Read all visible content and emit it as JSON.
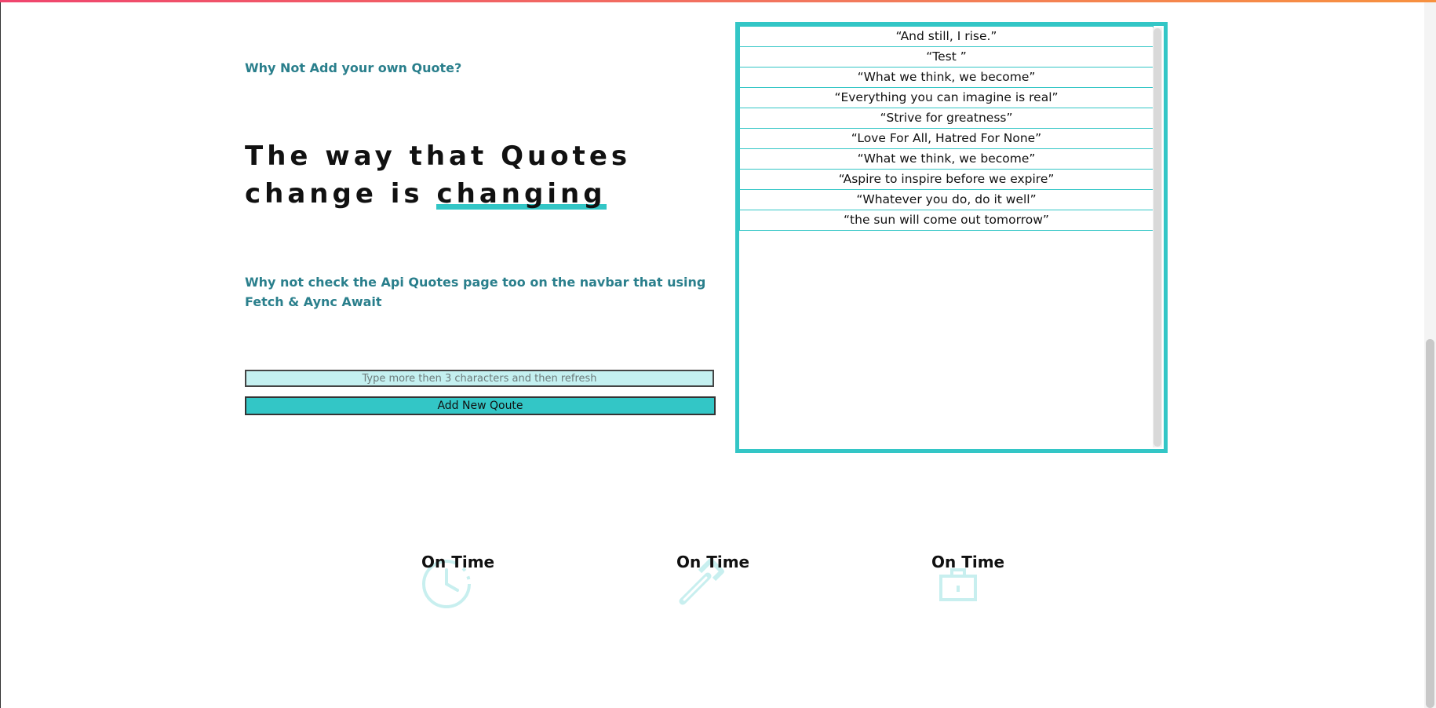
{
  "colors": {
    "accent": "#33c6c6",
    "heading_teal": "#2a7f8c",
    "input_bg": "#c4f0f0",
    "top_gradient": [
      "#f0456e",
      "#f7913f"
    ]
  },
  "intro": {
    "heading": "Why Not Add your own Quote?"
  },
  "hero": {
    "title_start": "The way that Quotes change is ",
    "title_highlight": "changing"
  },
  "note": {
    "text": "Why not check the Api Quotes page too on the navbar that using Fetch & Aync Await"
  },
  "form": {
    "input_placeholder": "Type more then 3 characters and then refresh",
    "input_value": "",
    "button_label": "Add New Qoute"
  },
  "quotes": [
    "“And still, I rise.”",
    "“Test ”",
    "“What we think, we become”",
    "“Everything you can imagine is real”",
    "“Strive for greatness”",
    "“Love For All, Hatred For None”",
    "“What we think, we become”",
    "“Aspire to inspire before we expire”",
    "“Whatever you do, do it well”",
    "“the sun will come out tomorrow”"
  ],
  "features": [
    {
      "title": "On Time",
      "icon": "clock-icon"
    },
    {
      "title": "On Time",
      "icon": "hammer-icon"
    },
    {
      "title": "On Time",
      "icon": "briefcase-icon"
    }
  ]
}
